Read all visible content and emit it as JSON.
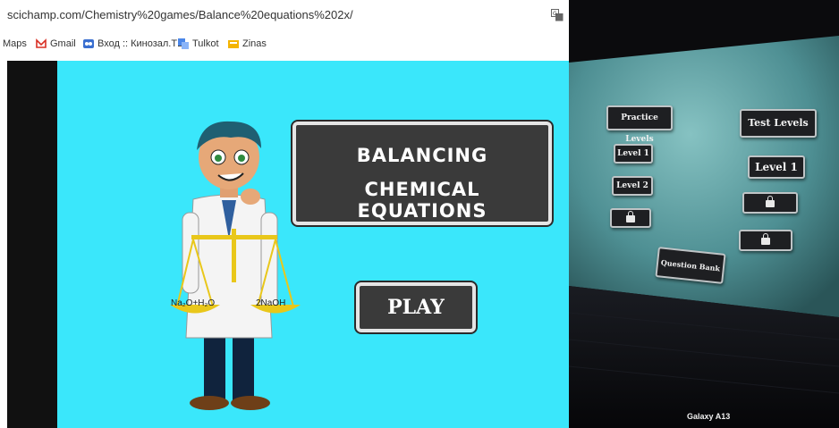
{
  "browser": {
    "url": "scichamp.com/Chemistry%20games/Balance%20equations%202x/",
    "bookmarks": [
      {
        "label": "Maps",
        "icon": "maps-icon"
      },
      {
        "label": "Gmail",
        "icon": "gmail-icon"
      },
      {
        "label": "Вход :: Кинозал.ТВ",
        "icon": "kinozal-icon"
      },
      {
        "label": "Tulkot",
        "icon": "translate-icon"
      },
      {
        "label": "Zinas",
        "icon": "news-icon"
      }
    ]
  },
  "game": {
    "title_line1": "BALANCING",
    "title_line2": "CHEMICAL EQUATIONS",
    "play_label": "PLAY",
    "scale_left_label": "Na₂O+H₂O",
    "scale_right_label": "2NaOH"
  },
  "phone_photo": {
    "practice_levels": "Practice Levels",
    "test_levels": "Test Levels",
    "practice_level1": "Level 1",
    "practice_level2": "Level 2",
    "test_level1": "Level 1",
    "question_bank": "Question Bank",
    "camera_watermark": "Galaxy A13"
  },
  "colors": {
    "game_background": "#3ae7fb",
    "button_dark": "#3a3a3a",
    "button_border": "#e5e5e5",
    "scale_gold": "#e9c71a"
  }
}
